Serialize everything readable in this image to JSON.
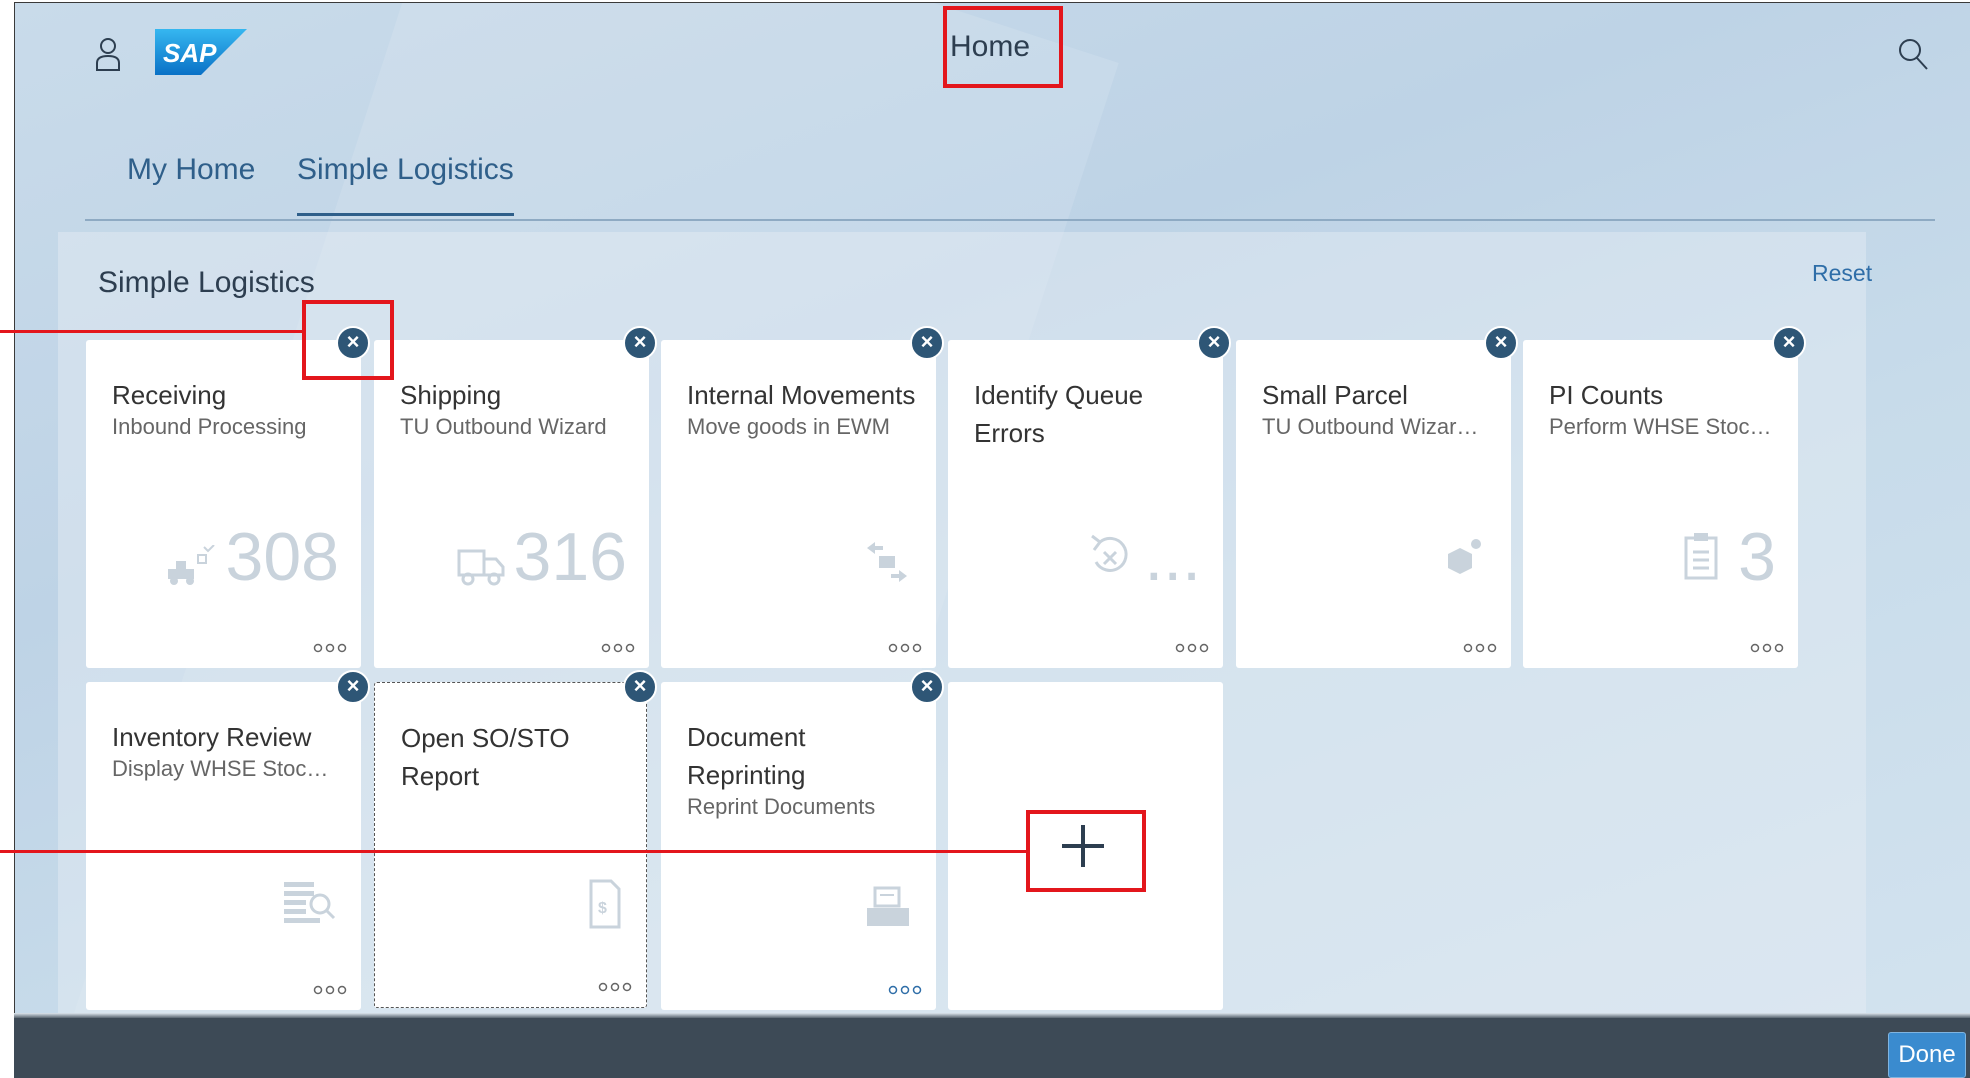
{
  "header": {
    "title": "Home"
  },
  "tabs": [
    {
      "label": "My Home",
      "selected": false
    },
    {
      "label": "Simple Logistics",
      "selected": true
    }
  ],
  "group": {
    "title": "Simple Logistics",
    "reset_label": "Reset"
  },
  "tiles": [
    {
      "title": "Receiving",
      "subtitle": "Inbound Processing",
      "number": "308",
      "icon": "forklift-icon"
    },
    {
      "title": "Shipping",
      "subtitle": "TU Outbound Wizard",
      "number": "316",
      "icon": "truck-icon"
    },
    {
      "title": "Internal Movements",
      "subtitle": "Move goods in EWM",
      "number": "",
      "icon": "move-arrows-icon"
    },
    {
      "title": "Identify Queue Errors",
      "subtitle": "",
      "number": "...",
      "icon": "undo-error-icon"
    },
    {
      "title": "Small Parcel",
      "subtitle": "TU Outbound Wizar…",
      "number": "",
      "icon": "parcel-gear-icon"
    },
    {
      "title": "PI Counts",
      "subtitle": "Perform WHSE Stoc…",
      "number": "3",
      "icon": "clipboard-icon"
    },
    {
      "title": "Inventory Review",
      "subtitle": "Display WHSE Stoc…",
      "number": "",
      "icon": "inventory-search-icon"
    },
    {
      "title": "Open SO/STO Report",
      "subtitle": "",
      "number": "",
      "icon": "document-dollar-icon"
    },
    {
      "title": "Document Reprinting",
      "subtitle": "Reprint Documents",
      "number": "",
      "icon": "printer-icon"
    }
  ],
  "footer": {
    "done_label": "Done"
  },
  "colors": {
    "accent": "#2f5f8a",
    "highlight": "#e3161c",
    "footer": "#3d4a56",
    "button": "#3a8bcf"
  }
}
